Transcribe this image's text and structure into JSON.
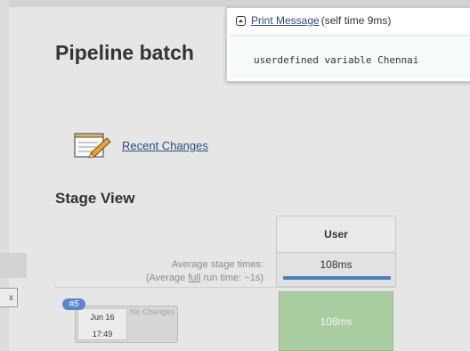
{
  "page": {
    "title": "Pipeline batch"
  },
  "links": {
    "recent_changes": "Recent Changes"
  },
  "stage_view": {
    "heading": "Stage View",
    "columns": [
      {
        "name": "User",
        "average_time": "108ms",
        "average_bar_fraction": 0.9
      }
    ],
    "average_label_line1": "Average stage times:",
    "average_label_line2_prefix": "(Average ",
    "average_label_line2_link": "full",
    "average_label_line2_suffix": " run time: ~1s)"
  },
  "runs": [
    {
      "badge": "#5",
      "date": "Jun 16",
      "time": "17:49",
      "changes": "No Changes",
      "stages": [
        {
          "time": "108ms",
          "status_color": "#a9cca0"
        }
      ]
    }
  ],
  "left_panel": {
    "close_glyph": "x"
  },
  "popup": {
    "step_link": "Print Message ",
    "self_time": "(self time 9ms)",
    "log_text": "userdefined variable Chennai"
  },
  "icons": {
    "step": "step-collapse-icon",
    "changes": "notepad-pencil-icon"
  },
  "colors": {
    "success": "#a9cca0",
    "link": "#2a4d7a",
    "badge": "#5b87c9",
    "progress": "#4a7fc0"
  }
}
